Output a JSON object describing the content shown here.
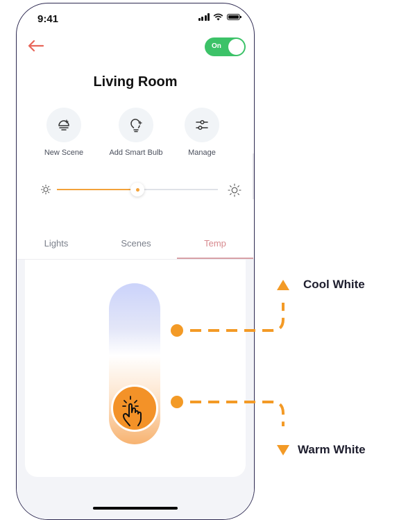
{
  "status_bar": {
    "time": "9:41"
  },
  "header": {
    "toggle_label": "On",
    "toggle_state": "on"
  },
  "room": {
    "title": "Living Room"
  },
  "actions": [
    {
      "label": "New Scene",
      "icon": "bulb-plus-icon"
    },
    {
      "label": "Add Smart Bulb",
      "icon": "smart-bulb-plus-icon"
    },
    {
      "label": "Manage",
      "icon": "sliders-icon"
    }
  ],
  "brightness": {
    "level": 0.5
  },
  "tabs": [
    {
      "label": "Lights",
      "active": false
    },
    {
      "label": "Scenes",
      "active": false
    },
    {
      "label": "Temp",
      "active": true
    }
  ],
  "temperature": {
    "level": 0.1
  },
  "callouts": {
    "cool": "Cool White",
    "warm": "Warm White"
  },
  "colors": {
    "accent": "#f39a26",
    "toggle_on": "#3cc268",
    "back_arrow": "#e8665a",
    "tab_active": "#d7898e"
  }
}
